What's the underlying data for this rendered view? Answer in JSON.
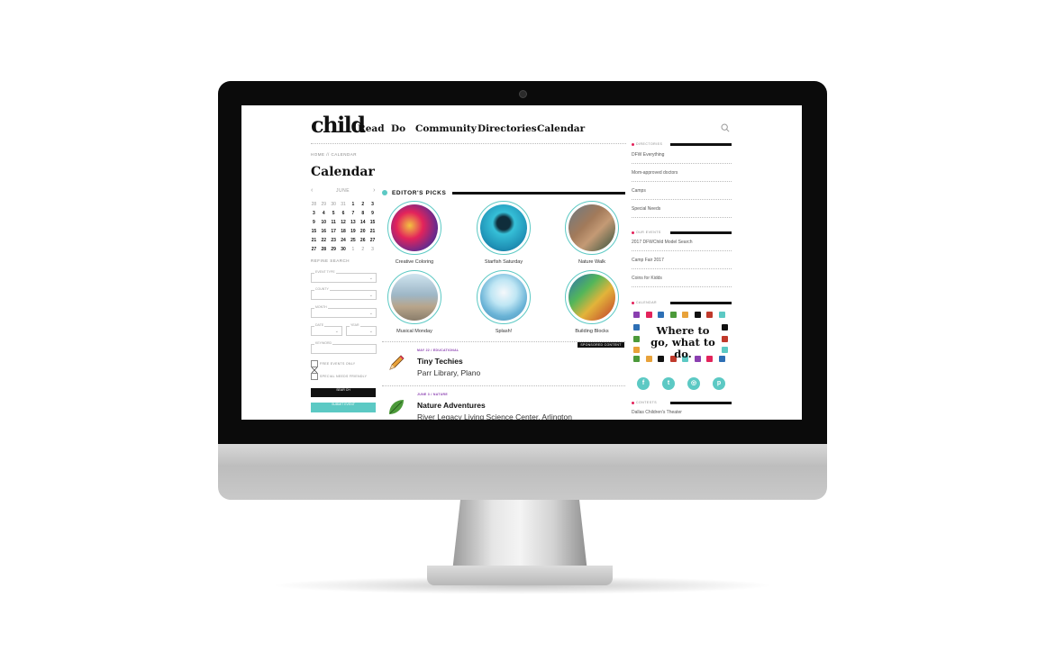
{
  "logo": "child",
  "nav": [
    "Read",
    "Do",
    "Community",
    "Directories",
    "Calendar"
  ],
  "breadcrumb": "HOME // CALENDAR",
  "page_title": "Calendar",
  "calendar": {
    "month": "JUNE",
    "days": [
      [
        "28",
        "29",
        "30",
        "31",
        "1",
        "2",
        "3"
      ],
      [
        "3",
        "4",
        "5",
        "6",
        "7",
        "8",
        "9"
      ],
      [
        "9",
        "10",
        "11",
        "12",
        "13",
        "14",
        "15"
      ],
      [
        "15",
        "16",
        "17",
        "18",
        "19",
        "20",
        "21"
      ],
      [
        "21",
        "22",
        "23",
        "24",
        "25",
        "26",
        "27"
      ],
      [
        "27",
        "28",
        "29",
        "30",
        "1",
        "2",
        "3"
      ]
    ]
  },
  "refine": {
    "title": "REFINE SEARCH",
    "event_type": "EVENT TYPE",
    "county": "COUNTY",
    "month": "MONTH",
    "date": "DATE",
    "year": "YEAR",
    "keyword": "KEYWORD",
    "free_only": "FREE EVENTS ONLY",
    "special_needs": "SPECIAL NEEDS FRIENDLY",
    "search_btn": "SEAR CH",
    "submit_btn": "SUBMIT EVENT"
  },
  "editors_picks": {
    "title": "EDITOR'S PICKS",
    "items": [
      "Creative Coloring",
      "Starfish Saturday",
      "Nature Walk",
      "Musical Monday",
      "Splash!",
      "Building Blocks"
    ]
  },
  "sponsored": "SPONSORED CONTENT",
  "events": [
    {
      "tag": "MAY 22 / EDUCATIONAL",
      "title": "Tiny Techies",
      "location": "Parr Library, Plano"
    },
    {
      "tag": "JUNE 3 / NATURE",
      "title": "Nature Adventures",
      "location": "River Legacy Living Science Center, Arlington"
    }
  ],
  "sidebar": {
    "directories_label": "DIRECTORIES",
    "directories": [
      "DFW Everything",
      "Mom-approved doctors",
      "Camps",
      "Special Needs"
    ],
    "events_label": "OUR EVENTS",
    "events": [
      "2017 DFWChild Model Search",
      "Camp Fair 2017",
      "Coins for Kidds"
    ],
    "calendar_label": "CALENDAR",
    "promo": "Where to go, what to do.",
    "contests_label": "CONTESTS",
    "contests": [
      "Dallas Children's Theater"
    ]
  },
  "colors": {
    "accent": "#5cc9c4",
    "pink": "#e3235b",
    "tag": "#8a3fb0"
  }
}
